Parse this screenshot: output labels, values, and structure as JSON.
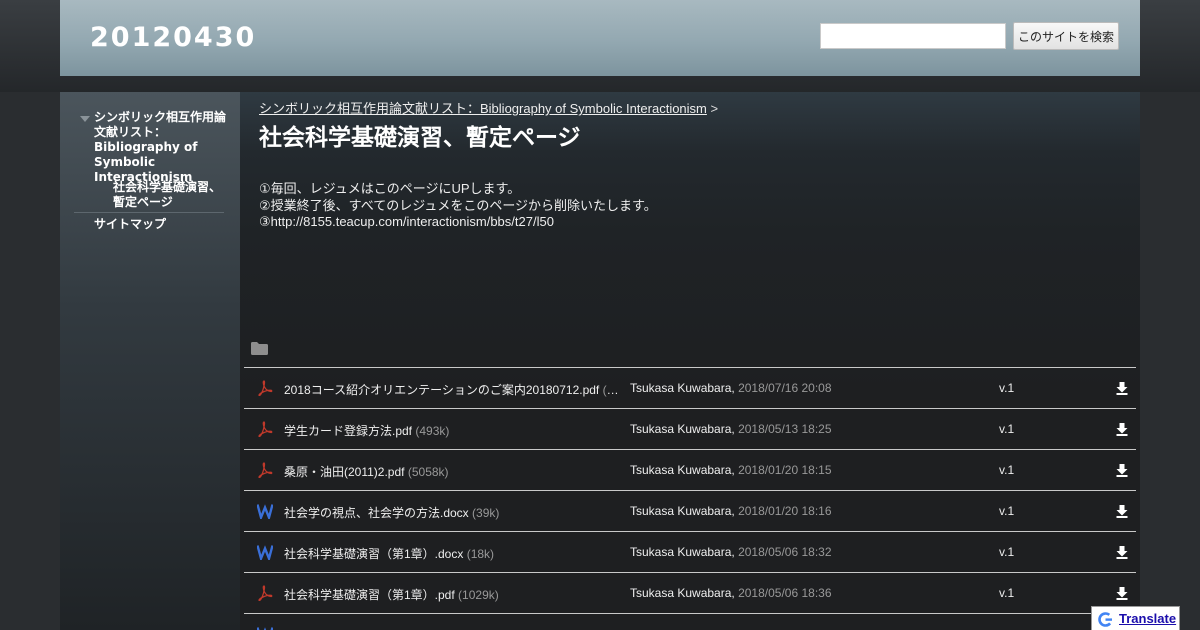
{
  "site": {
    "title": "20120430"
  },
  "search": {
    "placeholder": "",
    "button_label": "このサイトを検索"
  },
  "sidebar": {
    "items": [
      {
        "label": "シンボリック相互作用論文献リスト：Bibliography of Symbolic Interactionism"
      },
      {
        "label": "社会科学基礎演習、暫定ページ"
      },
      {
        "label": "サイトマップ"
      }
    ]
  },
  "breadcrumb": {
    "parent_label": "シンボリック相互作用論文献リスト：Bibliography of Symbolic Interactionism",
    "separator": ">"
  },
  "page": {
    "title": "社会科学基礎演習、暫定ページ",
    "body_lines": [
      "①毎回、レジュメはこのページにUPします。",
      "②授業終了後、すべてのレジュメをこのページから削除いたします。",
      "③http://8155.teacup.com/interactionism/bbs/t27/l50"
    ]
  },
  "files": [
    {
      "type": "pdf",
      "name": "2018コース紹介オリエンテーションのご案内20180712.pdf",
      "size": "(…)",
      "author": "Tsukasa Kuwabara,",
      "date": "2018/07/16 20:08",
      "version": "v.1"
    },
    {
      "type": "pdf",
      "name": "学生カード登録方法.pdf",
      "size": "(493k)",
      "author": "Tsukasa Kuwabara,",
      "date": "2018/05/13 18:25",
      "version": "v.1"
    },
    {
      "type": "pdf",
      "name": "桑原・油田(2011)2.pdf",
      "size": "(5058k)",
      "author": "Tsukasa Kuwabara,",
      "date": "2018/01/20 18:15",
      "version": "v.1"
    },
    {
      "type": "word",
      "name": "社会学の視点、社会学の方法.docx",
      "size": "(39k)",
      "author": "Tsukasa Kuwabara,",
      "date": "2018/01/20 18:16",
      "version": "v.1"
    },
    {
      "type": "word",
      "name": "社会科学基礎演習（第1章）.docx",
      "size": "(18k)",
      "author": "Tsukasa Kuwabara,",
      "date": "2018/05/06 18:32",
      "version": "v.1"
    },
    {
      "type": "pdf",
      "name": "社会科学基礎演習（第1章）.pdf",
      "size": "(1029k)",
      "author": "Tsukasa Kuwabara,",
      "date": "2018/05/06 18:36",
      "version": "v.1"
    },
    {
      "type": "word",
      "name": "",
      "size": "",
      "author": "",
      "date": "",
      "version": ""
    }
  ],
  "translate": {
    "label": "Translate"
  },
  "colors": {
    "header": "#93a8b1",
    "pdf_icon": "#c0392b",
    "word_icon": "#3a6fd8"
  }
}
